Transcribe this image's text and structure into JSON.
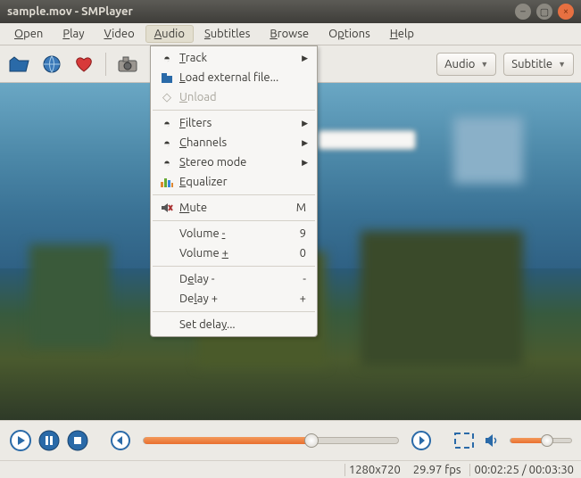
{
  "window": {
    "title": "sample.mov - SMPlayer"
  },
  "menubar": {
    "open": "Open",
    "open_u": "O",
    "play": "Play",
    "play_u": "P",
    "video": "Video",
    "video_u": "V",
    "audio": "Audio",
    "audio_u": "A",
    "subtitles": "Subtitles",
    "subtitles_u": "S",
    "browse": "Browse",
    "browse_u": "B",
    "options": "Options",
    "options_u": "p",
    "help": "Help",
    "help_u": "H"
  },
  "toolbar": {
    "audio_btn": "Audio",
    "subtitle_btn": "Subtitle"
  },
  "audio_menu": {
    "track": "Track",
    "track_u": "T",
    "load_external": "Load external file...",
    "load_external_u": "L",
    "unload": "Unload",
    "unload_u": "U",
    "filters": "Filters",
    "filters_u": "F",
    "channels": "Channels",
    "channels_u": "C",
    "stereo": "Stereo mode",
    "stereo_u": "S",
    "equalizer": "Equalizer",
    "equalizer_u": "E",
    "mute": "Mute",
    "mute_u": "M",
    "mute_key": "M",
    "vol_minus": "Volume -",
    "vol_minus_u": "-",
    "vol_minus_key": "9",
    "vol_plus": "Volume +",
    "vol_plus_u": "+",
    "vol_plus_key": "0",
    "delay_minus": "Delay -",
    "delay_minus_u": "e",
    "delay_minus_key": "-",
    "delay_plus": "Delay +",
    "delay_plus_u": "l",
    "delay_plus_key": "+",
    "set_delay": "Set delay...",
    "set_delay_u": "y"
  },
  "status": {
    "resolution": "1280x720",
    "fps": "29.97 fps",
    "time": "00:02:25 / 00:03:30"
  },
  "colors": {
    "accent": "#e96f2f"
  }
}
